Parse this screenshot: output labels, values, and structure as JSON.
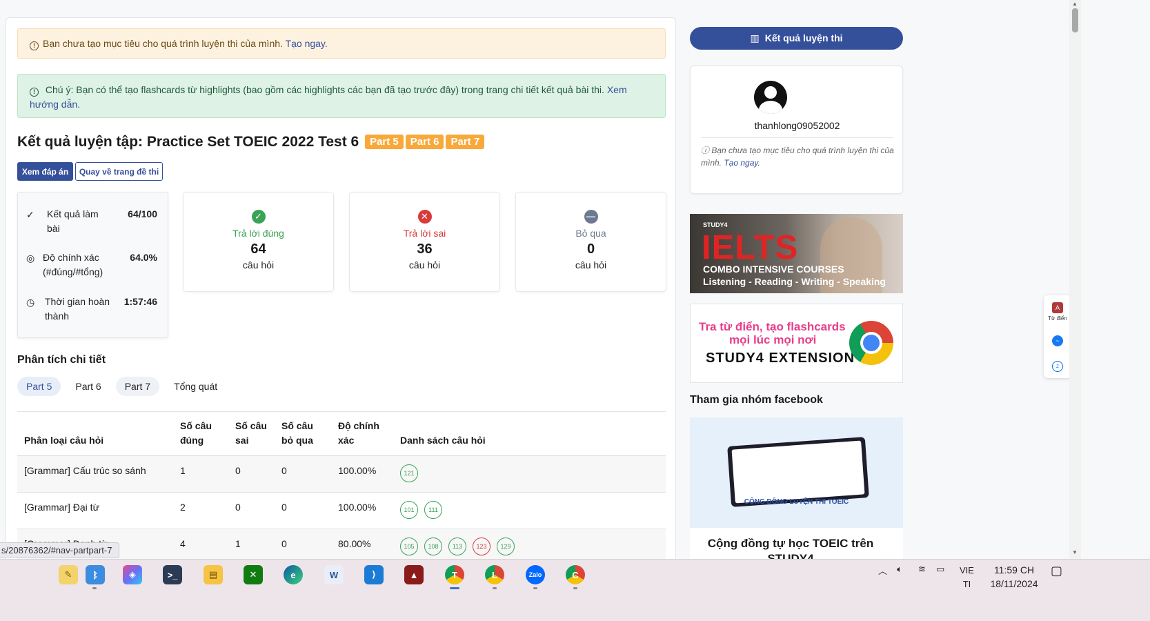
{
  "alerts": {
    "goal_text": "Bạn chưa tạo mục tiêu cho quá trình luyện thi của mình.",
    "goal_link": "Tạo ngay.",
    "info_text": "Chú ý: Bạn có thể tạo flashcards từ highlights (bao gồm các highlights các bạn đã tạo trước đây) trong trang chi tiết kết quả bài thi.",
    "info_link": "Xem hướng dẫn."
  },
  "page": {
    "title": "Kết quả luyện tập: Practice Set TOEIC 2022 Test 6",
    "parts": [
      "Part 5",
      "Part 6",
      "Part 7"
    ],
    "view_answers_button": "Xem đáp án",
    "back_button": "Quay về trang đề thi"
  },
  "summary": [
    {
      "icon": "check-icon",
      "label": "Kết quả làm bài",
      "value": "64/100"
    },
    {
      "icon": "target-icon",
      "label": "Độ chính xác (#đúng/#tổng)",
      "value": "64.0%"
    },
    {
      "icon": "clock-icon",
      "label": "Thời gian hoàn thành",
      "value": "1:57:46"
    }
  ],
  "stats": {
    "correct": {
      "label": "Trả lời đúng",
      "count": "64",
      "unit": "câu hỏi",
      "color": "#3aa357"
    },
    "wrong": {
      "label": "Trả lời sai",
      "count": "36",
      "unit": "câu hỏi",
      "color": "#d93a3a"
    },
    "skipped": {
      "label": "Bỏ qua",
      "count": "0",
      "unit": "câu hỏi",
      "color": "#6c7a91"
    }
  },
  "analysis": {
    "title": "Phân tích chi tiết",
    "tabs": [
      "Part 5",
      "Part 6",
      "Part 7",
      "Tổng quát"
    ],
    "active_tab": "Part 5",
    "columns": [
      "Phân loại câu hỏi",
      "Số câu đúng",
      "Số câu sai",
      "Số câu bỏ qua",
      "Độ chính xác",
      "Danh sách câu hỏi"
    ],
    "rows": [
      {
        "type": "[Grammar] Cấu trúc so sánh",
        "correct": "1",
        "wrong": "0",
        "skipped": "0",
        "accuracy": "100.00%",
        "questions": [
          {
            "n": "121",
            "ok": true
          }
        ]
      },
      {
        "type": "[Grammar] Đại từ",
        "correct": "2",
        "wrong": "0",
        "skipped": "0",
        "accuracy": "100.00%",
        "questions": [
          {
            "n": "101",
            "ok": true
          },
          {
            "n": "111",
            "ok": true
          }
        ]
      },
      {
        "type": "[Grammar] Danh từ",
        "correct": "4",
        "wrong": "1",
        "skipped": "0",
        "accuracy": "80.00%",
        "questions": [
          {
            "n": "105",
            "ok": true
          },
          {
            "n": "108",
            "ok": true
          },
          {
            "n": "113",
            "ok": true
          },
          {
            "n": "123",
            "ok": false
          },
          {
            "n": "129",
            "ok": true
          }
        ]
      }
    ]
  },
  "sidebar": {
    "results_button": "Kết quả luyện thi",
    "username": "thanhlong09052002",
    "goal_note": "Bạn chưa tạo mục tiêu cho quá trình luyện thi của mình.",
    "goal_link": "Tạo ngay.",
    "ielts_banner": {
      "brand": "STUDY4",
      "headline": "IELTS",
      "line1": "COMBO INTENSIVE COURSES",
      "line2": "Listening - Reading - Writing - Speaking"
    },
    "extension_banner": {
      "line1": "Tra từ điển, tạo flashcards",
      "line2": "mọi lúc mọi nơi",
      "line3": "STUDY4 EXTENSION"
    },
    "fb_title": "Tham gia nhóm facebook",
    "fb_banner_caption": "CỘNG ĐỒNG LUYỆN THI TOEIC",
    "fb_card_title": "Cộng đồng tự học TOEIC trên STUDY4"
  },
  "floating": {
    "dictionary_label": "Từ điển"
  },
  "status_url": "s/20876362/#nav-partpart-7",
  "taskbar": {
    "apps": [
      "notes-app",
      "bluetooth-app",
      "copilot-app",
      "terminal-app",
      "file-explorer",
      "xbox-app",
      "edge-browser",
      "word-app",
      "vscode-app",
      "game-app",
      "chrome-t",
      "chrome-l",
      "zalo-app",
      "chrome-c"
    ],
    "lang": "VIE",
    "lang2": "TI",
    "time": "11:59 CH",
    "date": "18/11/2024"
  }
}
